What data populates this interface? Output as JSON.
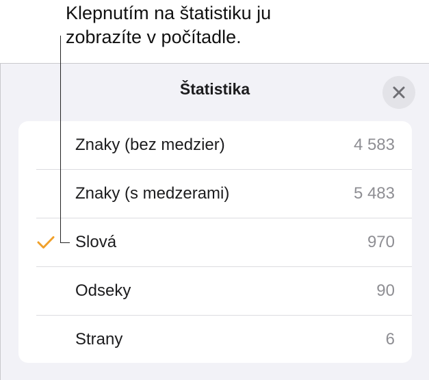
{
  "callout": {
    "line1": "Klepnutím na štatistiku ju",
    "line2": "zobrazíte v počítadle."
  },
  "panel": {
    "title": "Štatistika",
    "close_icon": "close-icon"
  },
  "stats": [
    {
      "label": "Znaky (bez medzier)",
      "value": "4 583",
      "checked": false
    },
    {
      "label": "Znaky (s medzerami)",
      "value": "5 483",
      "checked": false
    },
    {
      "label": "Slová",
      "value": "970",
      "checked": true
    },
    {
      "label": "Odseky",
      "value": "90",
      "checked": false
    },
    {
      "label": "Strany",
      "value": "6",
      "checked": false
    }
  ],
  "colors": {
    "accent_check": "#f0a02a",
    "panel_background": "#f2f2f7",
    "value_text": "#8e8e93"
  }
}
